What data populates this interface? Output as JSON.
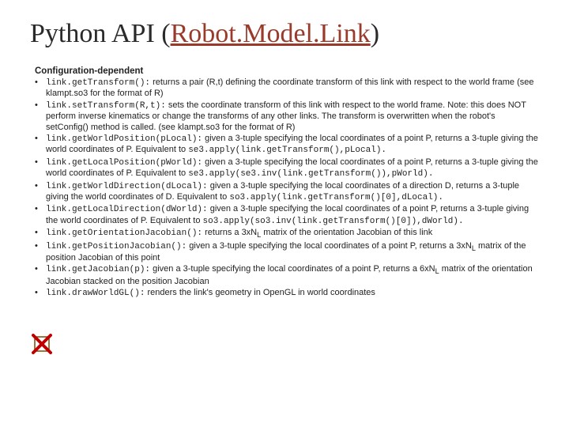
{
  "title": {
    "pre": "Python API (",
    "link": "Robot.Model.Link",
    "post": ")"
  },
  "section_head": "Configuration-dependent",
  "items": [
    {
      "code": "link.getTransform():",
      "rest": " returns a pair (R,t) defining the coordinate transform of this link with respect to the world frame (see klampt.so3 for the format of R)"
    },
    {
      "code": "link.setTransform(R,t):",
      "rest": " sets the coordinate transform of this link with respect to the world frame. Note: this does NOT perform inverse kinematics or change the transforms of any other links. The transform is overwritten when the robot's setConfig() method is called. (see klampt.so3 for the format of R)"
    },
    {
      "code": "link.getWorldPosition(pLocal):",
      "rest": " given a 3-tuple specifying the local coordinates of a point P, returns a 3-tuple giving the world coordinates of P. Equivalent to ",
      "code2": "se3.apply(link.getTransform(),pLocal).",
      "rest2": ""
    },
    {
      "code": "link.getLocalPosition(pWorld):",
      "rest": " given a 3-tuple specifying the local coordinates of a point P, returns a 3-tuple giving the world coordinates of P. Equivalent to ",
      "code2": "se3.apply(se3.inv(link.getTransform()),pWorld).",
      "rest2": ""
    },
    {
      "code": "link.getWorldDirection(dLocal):",
      "rest": " given a 3-tuple specifying the local coordinates of a direction D, returns a 3-tuple giving the world coordinates of D. Equivalent to ",
      "code2": "so3.apply(link.getTransform()[0],dLocal).",
      "rest2": ""
    },
    {
      "code": "link.getLocalDirection(dWorld):",
      "rest": " given a 3-tuple specifying the local coordinates of a point P, returns a 3-tuple giving the world coordinates of P. Equivalent to ",
      "code2": "so3.apply(so3.inv(link.getTransform()[0]),dWorld).",
      "rest2": ""
    },
    {
      "code": "link.getOrientationJacobian():",
      "rest": " returns a 3xN",
      "sub": "L",
      "rest2": " matrix of the orientation Jacobian of this link"
    },
    {
      "code": "link.getPositionJacobian():",
      "rest": " given a 3-tuple specifying the local coordinates of a point P, returns a 3xN",
      "sub": "L",
      "rest2": " matrix of the position Jacobian of this point"
    },
    {
      "code": "link.getJacobian(p):",
      "rest": " given a 3-tuple specifying the local coordinates of a point P, returns a 6xN",
      "sub": "L",
      "rest2": " matrix of the orientation Jacobian stacked on the position Jacobian"
    },
    {
      "code": "link.drawWorldGL():",
      "rest": " renders the link's geometry in OpenGL in world coordinates"
    }
  ]
}
